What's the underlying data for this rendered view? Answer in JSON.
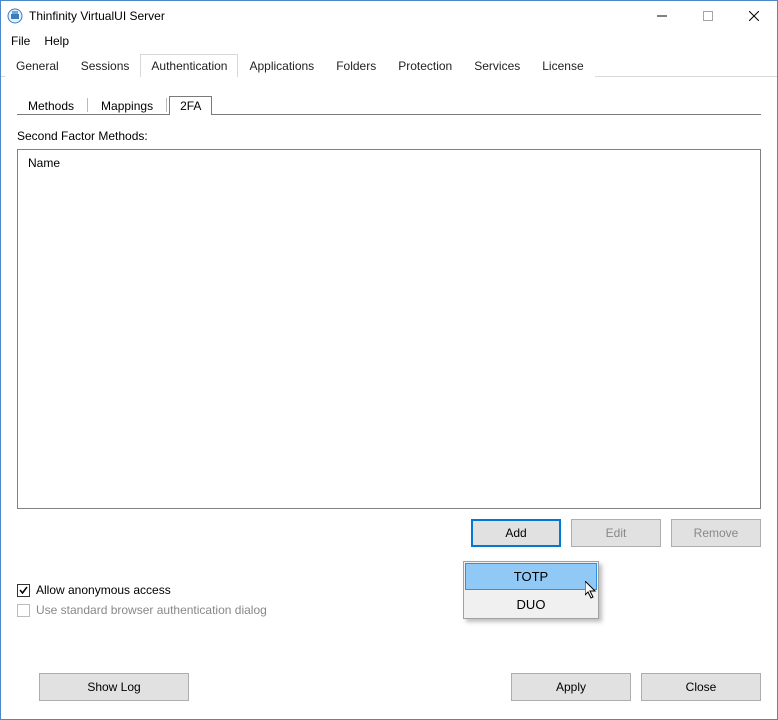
{
  "window": {
    "title": "Thinfinity VirtualUI Server"
  },
  "menubar": {
    "items": [
      "File",
      "Help"
    ]
  },
  "tabs": {
    "items": [
      "General",
      "Sessions",
      "Authentication",
      "Applications",
      "Folders",
      "Protection",
      "Services",
      "License"
    ],
    "active_index": 2
  },
  "subtabs": {
    "items": [
      "Methods",
      "Mappings",
      "2FA"
    ],
    "active_index": 2
  },
  "section": {
    "label": "Second Factor Methods:",
    "column_header": "Name"
  },
  "buttons": {
    "add": "Add",
    "edit": "Edit",
    "remove": "Remove"
  },
  "checkboxes": {
    "allow_anonymous": {
      "label": "Allow anonymous access",
      "checked": true
    },
    "standard_dialog": {
      "label": "Use standard browser authentication dialog",
      "checked": false,
      "disabled": true
    }
  },
  "footer": {
    "show_log": "Show Log",
    "apply": "Apply",
    "close": "Close"
  },
  "dropdown": {
    "items": [
      "TOTP",
      "DUO"
    ],
    "highlight_index": 0
  }
}
